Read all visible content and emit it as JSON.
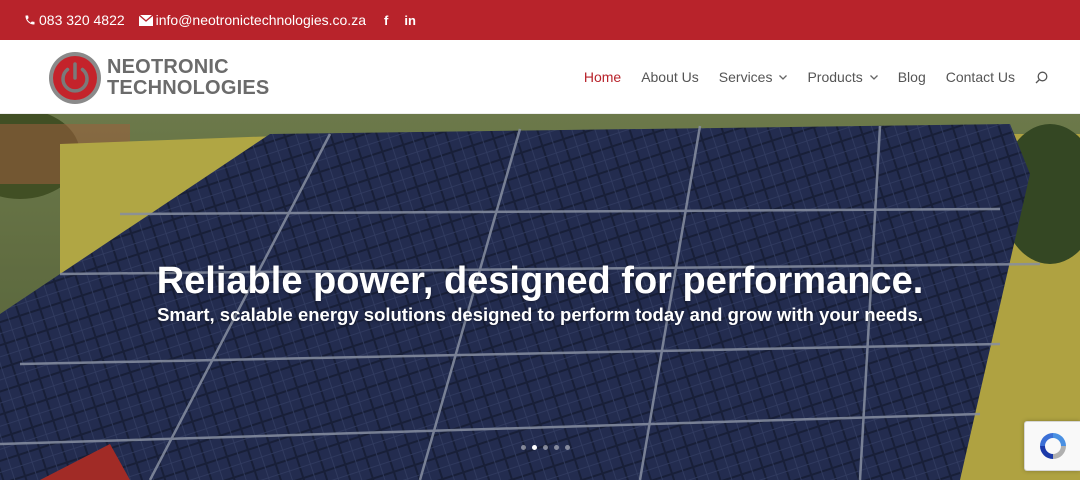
{
  "topbar": {
    "phone": "083 320 4822",
    "email": "info@neotronictechnologies.co.za",
    "social": [
      {
        "name": "facebook-icon",
        "label": "f"
      },
      {
        "name": "linkedin-icon",
        "label": "in"
      }
    ],
    "background": "#b8232b"
  },
  "logo": {
    "line1": "NEOTRONIC",
    "line2": "TECHNOLOGIES"
  },
  "nav": {
    "items": [
      {
        "label": "Home",
        "active": true
      },
      {
        "label": "About Us"
      },
      {
        "label": "Services",
        "dropdown": true
      },
      {
        "label": "Products",
        "dropdown": true
      },
      {
        "label": "Blog"
      },
      {
        "label": "Contact Us"
      }
    ],
    "search_icon": "search-icon",
    "active_color": "#b8232b"
  },
  "hero": {
    "title": "Reliable power, designed for performance.",
    "subtitle": "Smart, scalable energy solutions designed to perform today and grow with your needs.",
    "slides": 5,
    "active_slide": 2
  },
  "recaptcha": {
    "icon": "recaptcha-icon"
  }
}
